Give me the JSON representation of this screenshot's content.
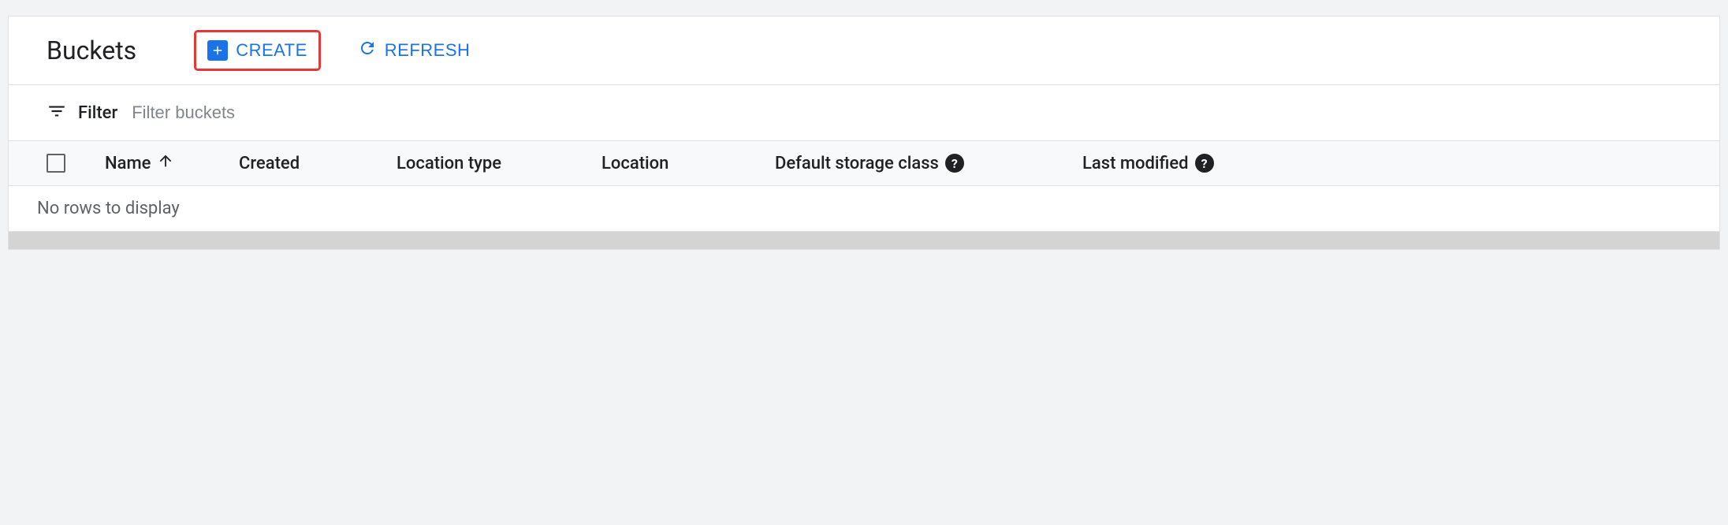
{
  "header": {
    "title": "Buckets",
    "create_label": "CREATE",
    "refresh_label": "REFRESH"
  },
  "filter": {
    "label": "Filter",
    "placeholder": "Filter buckets"
  },
  "table": {
    "columns": {
      "name": "Name",
      "created": "Created",
      "location_type": "Location type",
      "location": "Location",
      "default_storage_class": "Default storage class",
      "last_modified": "Last modified"
    },
    "sort_column": "name",
    "sort_direction": "asc",
    "empty_message": "No rows to display",
    "rows": []
  },
  "colors": {
    "accent": "#1a73e8",
    "highlight_border": "#e53935",
    "text_primary": "#202124",
    "text_secondary": "#5f6368"
  }
}
